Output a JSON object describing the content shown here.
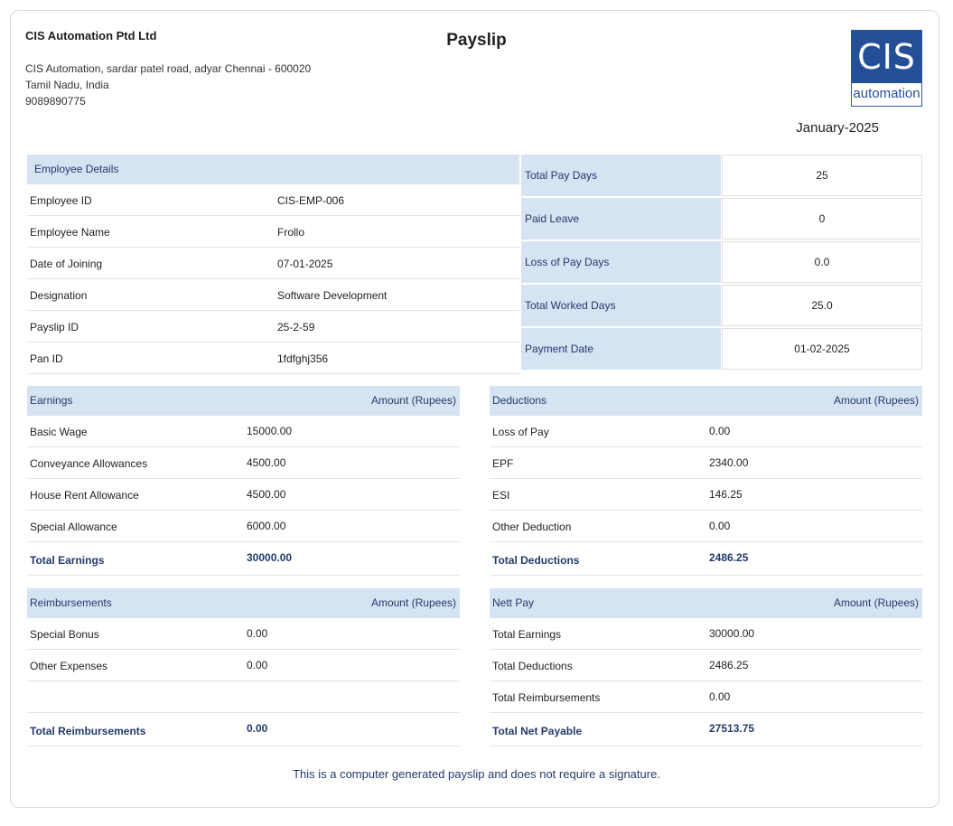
{
  "company": {
    "name": "CIS Automation Ptd Ltd",
    "address_line1": "CIS Automation, sardar patel road, adyar Chennai - 600020",
    "address_line2": "Tamil Nadu, India",
    "phone": "9089890775",
    "logo_top": "CIS",
    "logo_bottom": "automation",
    "logo_colors": {
      "primary": "#244f97"
    }
  },
  "title": "Payslip",
  "period": "January-2025",
  "employee": {
    "header": "Employee Details",
    "rows": [
      {
        "label": "Employee ID",
        "value": "CIS-EMP-006"
      },
      {
        "label": "Employee Name",
        "value": "Frollo"
      },
      {
        "label": "Date of Joining",
        "value": "07-01-2025"
      },
      {
        "label": "Designation",
        "value": "Software Development"
      },
      {
        "label": "Payslip ID",
        "value": "25-2-59"
      },
      {
        "label": "Pan ID",
        "value": "1fdfghj356"
      }
    ]
  },
  "pay_days": [
    {
      "label": "Total Pay Days",
      "value": "25"
    },
    {
      "label": "Paid Leave",
      "value": "0"
    },
    {
      "label": "Loss of Pay Days",
      "value": "0.0"
    },
    {
      "label": "Total Worked Days",
      "value": "25.0"
    },
    {
      "label": "Payment Date",
      "value": "01-02-2025"
    }
  ],
  "earnings": {
    "header": "Earnings",
    "amount_header": "Amount (Rupees)",
    "rows": [
      {
        "label": "Basic Wage",
        "value": "15000.00"
      },
      {
        "label": "Conveyance Allowances",
        "value": "4500.00"
      },
      {
        "label": "House Rent Allowance",
        "value": "4500.00"
      },
      {
        "label": "Special Allowance",
        "value": "6000.00"
      }
    ],
    "total_label": "Total Earnings",
    "total_value": "30000.00"
  },
  "deductions": {
    "header": "Deductions",
    "amount_header": "Amount (Rupees)",
    "rows": [
      {
        "label": "Loss of Pay",
        "value": "0.00"
      },
      {
        "label": "EPF",
        "value": "2340.00"
      },
      {
        "label": "ESI",
        "value": "146.25"
      },
      {
        "label": "Other Deduction",
        "value": "0.00"
      }
    ],
    "total_label": "Total Deductions",
    "total_value": "2486.25"
  },
  "reimbursements": {
    "header": "Reimbursements",
    "amount_header": "Amount (Rupees)",
    "rows": [
      {
        "label": "Special Bonus",
        "value": "0.00"
      },
      {
        "label": "Other Expenses",
        "value": "0.00"
      }
    ],
    "total_label": "Total Reimbursements",
    "total_value": "0.00"
  },
  "nett_pay": {
    "header": "Nett Pay",
    "amount_header": "Amount (Rupees)",
    "rows": [
      {
        "label": "Total Earnings",
        "value": "30000.00"
      },
      {
        "label": "Total Deductions",
        "value": "2486.25"
      },
      {
        "label": "Total Reimbursements",
        "value": "0.00"
      }
    ],
    "total_label": "Total Net Payable",
    "total_value": "27513.75"
  },
  "footer_note": "This is a computer generated payslip and does not require a signature."
}
